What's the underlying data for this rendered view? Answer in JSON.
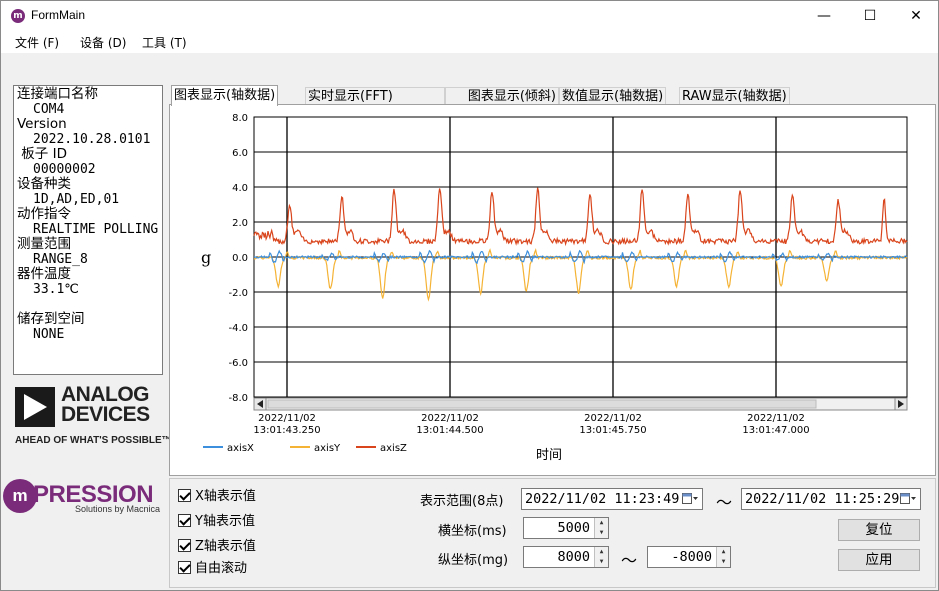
{
  "window": {
    "title": "FormMain",
    "minimize": "—",
    "maximize": "☐",
    "close": "✕"
  },
  "menu": [
    "文件 (F)",
    "设备 (D)",
    "工具 (T)"
  ],
  "info": {
    "port_label": "连接端口名称",
    "port_value": "COM4",
    "version_label": "Version",
    "version_value": "2022.10.28.0101",
    "board_label": " 板子 ID",
    "board_value": "00000002",
    "device_label": "设备种类",
    "device_value": "1D,AD,ED,01",
    "action_label": "动作指令",
    "action_value": "REALTIME POLLING",
    "range_label": "测量范围",
    "range_value": "RANGE_8",
    "temp_label": "器件温度",
    "temp_value": "33.1℃",
    "storage_label": "储存到空间",
    "storage_value": "NONE"
  },
  "logos": {
    "adi_line1": "ANALOG",
    "adi_line2": "DEVICES",
    "adi_tagline": "AHEAD OF WHAT'S POSSIBLE™",
    "mp_m": "m",
    "mp_name": "PRESSION",
    "mp_sub": "Solutions by Macnica"
  },
  "tabs": [
    "图表显示(轴数据)",
    "实时显示(FFT)",
    "图表显示(倾斜)",
    "数值显示(轴数据)",
    "RAW显示(轴数据)"
  ],
  "controls": {
    "chk_x": "X轴表示值",
    "chk_y": "Y轴表示值",
    "chk_z": "Z轴表示值",
    "chk_scroll": "自由滚动",
    "range_label": "表示范围(8点)",
    "range_start": "2022/11/02 11:23:49",
    "range_end": "2022/11/02 11:25:29",
    "tilde": "～",
    "xscale_label": "横坐标(ms)",
    "xscale_value": "5000",
    "yscale_label": "纵坐标(mg)",
    "ymax_value": "8000",
    "ymin_value": "-8000",
    "reset_btn": "复位",
    "apply_btn": "应用"
  },
  "chart_data": {
    "type": "line",
    "ylabel": "g",
    "xlabel": "时间",
    "ylim": [
      -8.0,
      8.0
    ],
    "yticks": [
      "8.0",
      "6.0",
      "4.0",
      "2.0",
      "0.0",
      "-2.0",
      "-4.0",
      "-6.0",
      "-8.0"
    ],
    "xticks": [
      {
        "date": "2022/11/02",
        "time": "13:01:43.250"
      },
      {
        "date": "2022/11/02",
        "time": "13:01:44.500"
      },
      {
        "date": "2022/11/02",
        "time": "13:01:45.750"
      },
      {
        "date": "2022/11/02",
        "time": "13:01:47.000"
      }
    ],
    "grid": true,
    "legend_position": "bottom-left",
    "series": [
      {
        "name": "axisX",
        "color": "#3c8fdc"
      },
      {
        "name": "axisY",
        "color": "#f5b335"
      },
      {
        "name": "axisZ",
        "color": "#d9451c"
      }
    ],
    "peaks": [
      {
        "t": 0.05,
        "x": 0.5,
        "y": -1.6,
        "z": 2.4
      },
      {
        "t": 0.13,
        "x": 0.3,
        "y": -1.8,
        "z": 3.0
      },
      {
        "t": 0.21,
        "x": 0.4,
        "y": -2.3,
        "z": 3.5
      },
      {
        "t": 0.28,
        "x": 0.5,
        "y": -2.4,
        "z": 3.6
      },
      {
        "t": 0.36,
        "x": 0.5,
        "y": -2.0,
        "z": 3.4
      },
      {
        "t": 0.43,
        "x": 0.5,
        "y": -1.9,
        "z": 3.5
      },
      {
        "t": 0.51,
        "x": 0.5,
        "y": -2.0,
        "z": 3.2
      },
      {
        "t": 0.59,
        "x": 0.4,
        "y": -1.8,
        "z": 3.5
      },
      {
        "t": 0.66,
        "x": 0.4,
        "y": -1.6,
        "z": 3.1
      },
      {
        "t": 0.74,
        "x": 0.4,
        "y": -1.7,
        "z": 3.4
      },
      {
        "t": 0.82,
        "x": 0.3,
        "y": -1.6,
        "z": 3.2
      },
      {
        "t": 0.89,
        "x": 0.3,
        "y": -1.3,
        "z": 2.8
      }
    ]
  }
}
